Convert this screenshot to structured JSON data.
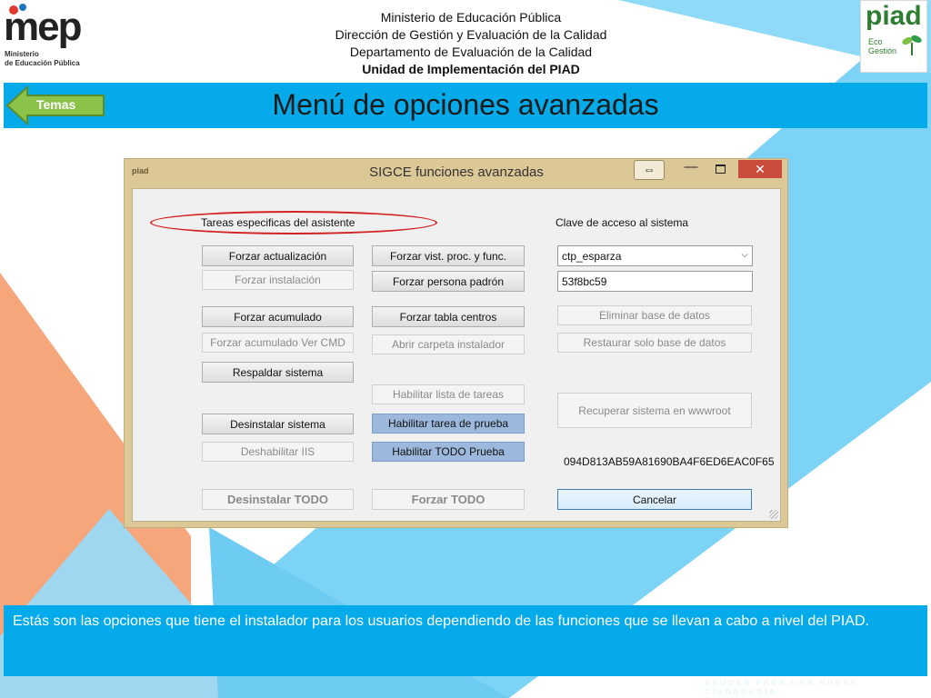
{
  "header": {
    "logo_mep": {
      "word": "mep",
      "subtitle_line1": "Ministerio",
      "subtitle_line2": "de Educación Pública"
    },
    "lines": [
      "Ministerio de Educación Pública",
      "Dirección de Gestión y Evaluación de la Calidad",
      "Departamento de Evaluación de la Calidad",
      "Unidad de Implementación del PIAD"
    ],
    "logo_piad": {
      "word": "piad",
      "sub1": "Eco",
      "sub2": "Gestión"
    }
  },
  "nav": {
    "back_label": "Temas"
  },
  "title": "Menú de opciones avanzadas",
  "dialog": {
    "app_icon_text": "piad",
    "window_title": "SIGCE funciones avanzadas",
    "resize_glyph": "⇔",
    "min_glyph": "—",
    "close_glyph": "✕",
    "section_label": "Tareas especificas del asistente",
    "password_label": "Clave de acceso al sistema",
    "buttons": {
      "forzar_actualizacion": "Forzar actualización",
      "forzar_instalacion": "Forzar instalación",
      "forzar_acumulado": "Forzar acumulado",
      "forzar_acumulado_ver_cmd": "Forzar acumulado Ver CMD",
      "respaldar_sistema": "Respaldar sistema",
      "desinstalar_sistema": "Desinstalar sistema",
      "deshabilitar_iis": "Deshabilitar IIS",
      "desinstalar_todo": "Desinstalar TODO",
      "forzar_vist_proc": "Forzar vist. proc. y func.",
      "forzar_persona_padron": "Forzar persona padrón",
      "forzar_tabla_centros": "Forzar tabla centros",
      "abrir_carpeta_instalador": "Abrir carpeta instalador",
      "habilitar_lista_tareas": "Habilitar lista de tareas",
      "habilitar_tarea_prueba": "Habilitar tarea de prueba",
      "habilitar_todo_prueba": "Habilitar TODO Prueba",
      "forzar_todo": "Forzar TODO",
      "eliminar_base_datos": "Eliminar base de datos",
      "restaurar_base_datos": "Restaurar solo base de datos",
      "recuperar_sistema": "Recuperar sistema en wwwroot",
      "cancelar": "Cancelar"
    },
    "user_select": {
      "value": "ctp_esparza"
    },
    "password_value": "53f8bc59",
    "hash_text": "094D813AB59A81690BA4F6ED6EAC0F65"
  },
  "caption": "Estás son las opciones que tiene el instalador para los usuarios dependiendo de las funciones que se llevan a cabo a nivel del PIAD.",
  "footer": "EDUCAR PARA UNA NUEVA CIUDADANÍA",
  "colors": {
    "accent_blue": "#05aaea",
    "light_blue": "#7dd3f5",
    "orange": "#f5a67a",
    "dialog_frame": "#dcc896"
  }
}
